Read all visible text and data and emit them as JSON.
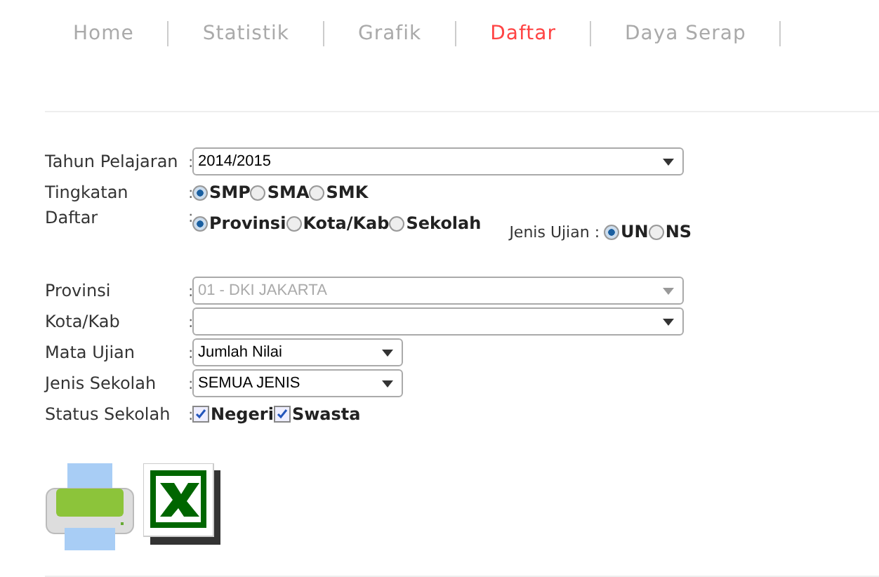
{
  "nav": [
    {
      "label": "Home",
      "selected": false
    },
    {
      "label": "Statistik",
      "selected": false
    },
    {
      "label": "Grafik",
      "selected": false
    },
    {
      "label": "Daftar",
      "selected": true
    },
    {
      "label": "Daya Serap",
      "selected": false
    }
  ],
  "form": [
    {
      "kind": "select",
      "label": "Tahun Pelajaran",
      "colon": ":",
      "value": "2014/2015",
      "disabled": false
    },
    {
      "kind": "radio",
      "label": "Tingkatan",
      "colon": ":",
      "options": [
        {
          "label": "SMP",
          "selected": true
        },
        {
          "label": "SMA",
          "selected": false
        },
        {
          "label": "SMK",
          "selected": false
        }
      ]
    },
    {
      "kind": "radio",
      "label": "Daftar",
      "colon": ":",
      "options": [
        {
          "label": "Provinsi",
          "selected": true
        },
        {
          "label": "Kota/Kab",
          "selected": false
        },
        {
          "label": "Sekolah",
          "selected": false
        }
      ],
      "extra": {
        "label": "Jenis Ujian :",
        "options": [
          {
            "label": "UN",
            "selected": true
          },
          {
            "label": "NS",
            "selected": false
          }
        ]
      }
    },
    {
      "kind": "spacer"
    },
    {
      "kind": "select",
      "label": "Provinsi",
      "colon": ":",
      "value": "01 - DKI JAKARTA",
      "disabled": true
    },
    {
      "kind": "select",
      "label": "Kota/Kab",
      "colon": ":",
      "disabled": false
    },
    {
      "kind": "short_select",
      "label": "Mata Ujian",
      "colon": ":",
      "value": "Jumlah Nilai",
      "disabled": false
    },
    {
      "kind": "short_select",
      "label": "Jenis Sekolah",
      "colon": ":",
      "value": "SEMUA JENIS",
      "disabled": false
    },
    {
      "kind": "checkbox",
      "label": "Status Sekolah",
      "colon": ":",
      "options": [
        {
          "label": "Negeri",
          "checked": true
        },
        {
          "label": "Swasta",
          "checked": true
        }
      ]
    }
  ]
}
